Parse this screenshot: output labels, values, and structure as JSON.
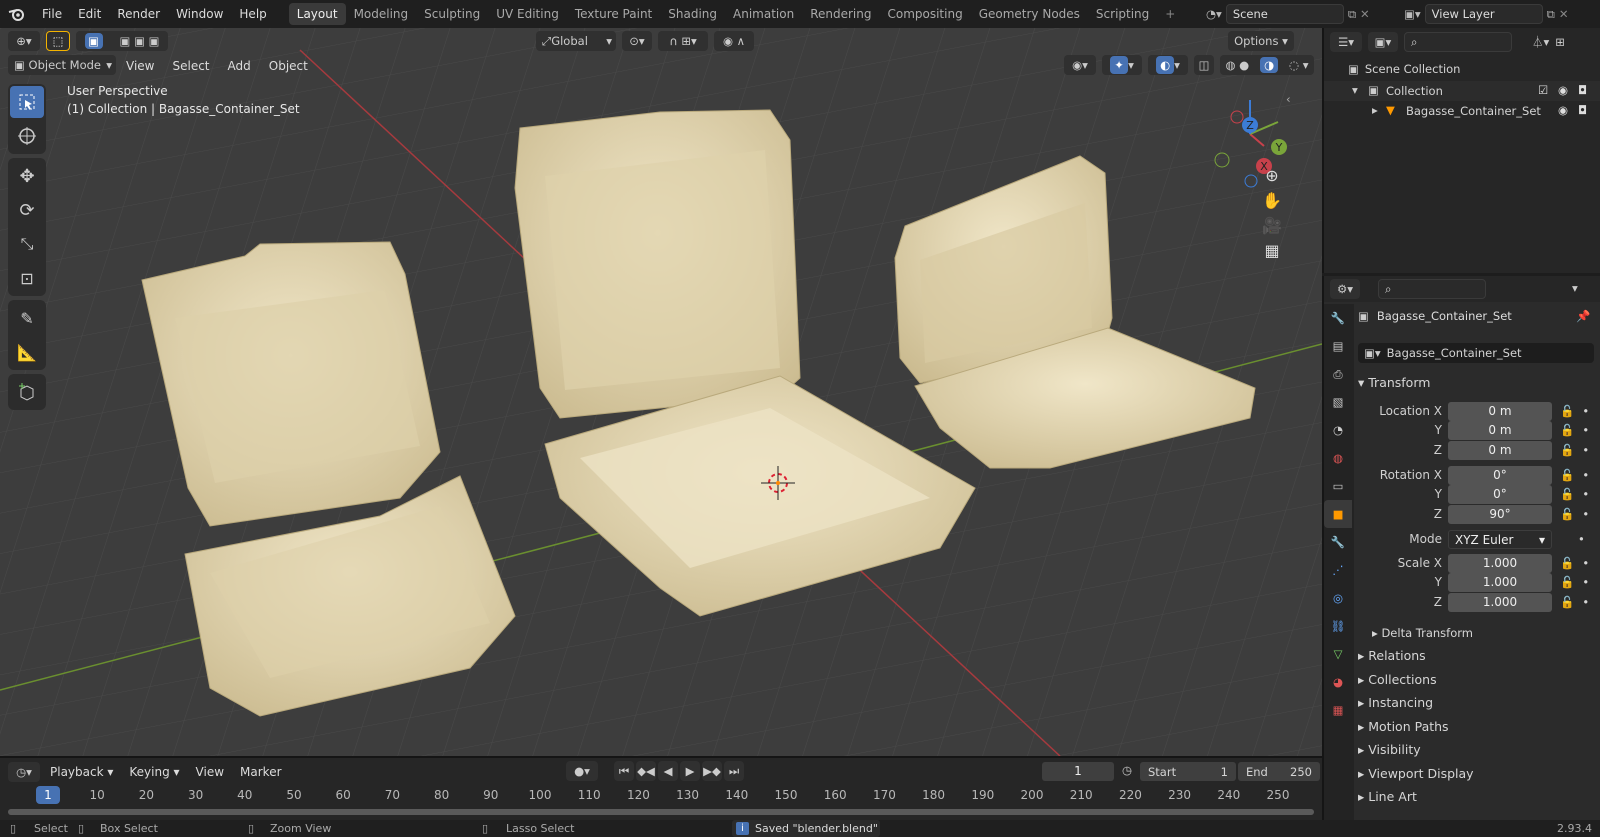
{
  "topbar": {
    "menus": [
      "File",
      "Edit",
      "Render",
      "Window",
      "Help"
    ],
    "workspaces": [
      "Layout",
      "Modeling",
      "Sculpting",
      "UV Editing",
      "Texture Paint",
      "Shading",
      "Animation",
      "Rendering",
      "Compositing",
      "Geometry Nodes",
      "Scripting"
    ],
    "active_workspace": "Layout",
    "scene": "Scene",
    "view_layer": "View Layer"
  },
  "viewport": {
    "transform_orientation": "Global",
    "options_label": "Options",
    "mode": "Object Mode",
    "menus": [
      "View",
      "Select",
      "Add",
      "Object"
    ],
    "perspective": "User Perspective",
    "collection_info": "(1) Collection | Bagasse_Container_Set",
    "gizmo": {
      "x": "X",
      "y": "Y",
      "z": "Z"
    }
  },
  "outliner": {
    "root": "Scene Collection",
    "collection": "Collection",
    "object": "Bagasse_Container_Set"
  },
  "properties": {
    "object_name": "Bagasse_Container_Set",
    "datablock": "Bagasse_Container_Set",
    "transform_label": "Transform",
    "location": {
      "label": "Location X",
      "x": "0 m",
      "y": "0 m",
      "z": "0 m"
    },
    "rotation": {
      "label": "Rotation X",
      "x": "0°",
      "y": "0°",
      "z": "90°"
    },
    "mode_label": "Mode",
    "mode_value": "XYZ Euler",
    "scale": {
      "label": "Scale X",
      "x": "1.000",
      "y": "1.000",
      "z": "1.000"
    },
    "axis_y": "Y",
    "axis_z": "Z",
    "delta": "Delta Transform",
    "panels": [
      "Relations",
      "Collections",
      "Instancing",
      "Motion Paths",
      "Visibility",
      "Viewport Display",
      "Line Art"
    ]
  },
  "timeline": {
    "menus": [
      "Playback",
      "Keying",
      "View",
      "Marker"
    ],
    "current_frame": "1",
    "start_label": "Start",
    "start": "1",
    "end_label": "End",
    "end": "250",
    "ticks": [
      "1",
      "10",
      "20",
      "30",
      "40",
      "50",
      "60",
      "70",
      "80",
      "90",
      "100",
      "110",
      "120",
      "130",
      "140",
      "150",
      "160",
      "170",
      "180",
      "190",
      "200",
      "210",
      "220",
      "230",
      "240",
      "250"
    ]
  },
  "statusbar": {
    "select": "Select",
    "box_select": "Box Select",
    "zoom_view": "Zoom View",
    "lasso_select": "Lasso Select",
    "message": "Saved \"blender.blend\"",
    "version": "2.93.4"
  },
  "colors": {
    "accent": "#4772b3",
    "x_axis": "#c8414b",
    "y_axis": "#7aa53a",
    "z_axis": "#3c7cd6",
    "container": "#e6d8b2"
  }
}
